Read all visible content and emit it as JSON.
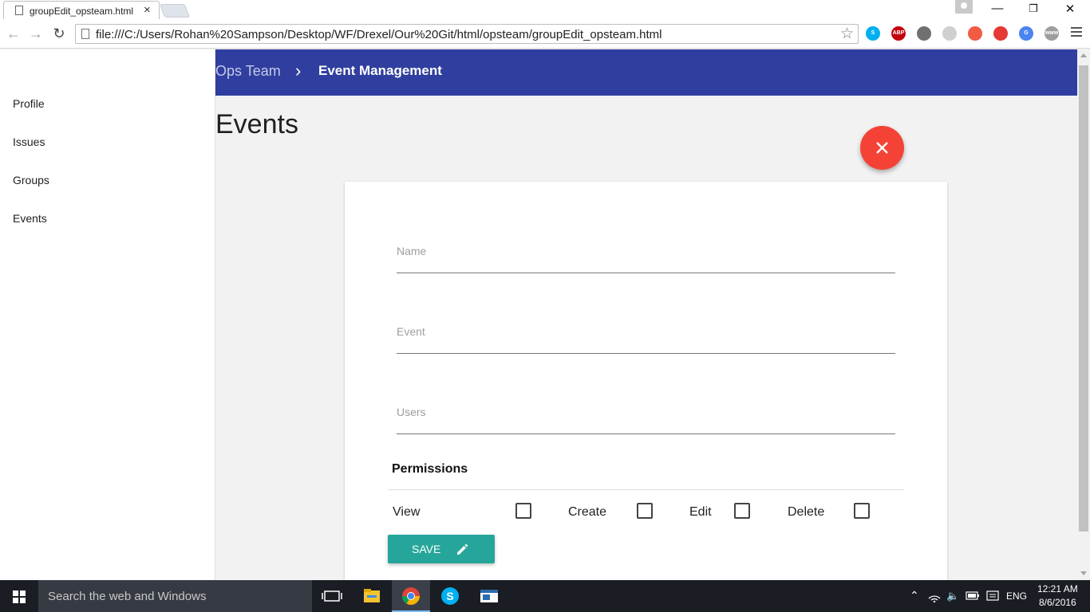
{
  "browser": {
    "tab_title": "groupEdit_opsteam.html",
    "tab_close": "×",
    "url": "file:///C:/Users/Rohan%20Sampson/Desktop/WF/Drexel/Our%20Git/html/opsteam/groupEdit_opsteam.html",
    "extensions": [
      {
        "icon": "skype-icon",
        "text": "S",
        "color": "#00aff0"
      },
      {
        "icon": "adblock-plus-icon",
        "text": "ABP",
        "color": "#c4000d"
      },
      {
        "icon": "lightbulb-icon",
        "text": "",
        "color": "#707070"
      },
      {
        "icon": "refresh-extension-icon",
        "text": "",
        "color": "#cfcfcf"
      },
      {
        "icon": "no-tracking-icon",
        "text": "",
        "color": "#f15a43"
      },
      {
        "icon": "target-icon",
        "text": "",
        "color": "#e53935"
      },
      {
        "icon": "google-translate-icon",
        "text": "G",
        "color": "#4a84f0"
      },
      {
        "icon": "www-icon",
        "text": "www",
        "color": "#9e9e9e"
      }
    ]
  },
  "sidebar": {
    "items": [
      {
        "label": "Profile"
      },
      {
        "label": "Issues"
      },
      {
        "label": "Groups"
      },
      {
        "label": "Events"
      }
    ]
  },
  "header": {
    "breadcrumb_parent": "Ops Team",
    "breadcrumb_separator": "›",
    "breadcrumb_current": "Event Management"
  },
  "main": {
    "title": "Events",
    "form": {
      "name_placeholder": "Name",
      "event_placeholder": "Event",
      "users_placeholder": "Users",
      "permissions_title": "Permissions",
      "permissions": [
        {
          "label": "View",
          "checked": false
        },
        {
          "label": "Create",
          "checked": false
        },
        {
          "label": "Edit",
          "checked": false
        },
        {
          "label": "Delete",
          "checked": false
        }
      ],
      "save_label": "SAVE"
    },
    "accent_colors": {
      "appbar": "#303f9f",
      "fab": "#f44336",
      "save_button": "#26a69a"
    }
  },
  "taskbar": {
    "search_placeholder": "Search the web and Windows",
    "language": "ENG",
    "time": "12:21 AM",
    "date": "8/6/2016"
  }
}
